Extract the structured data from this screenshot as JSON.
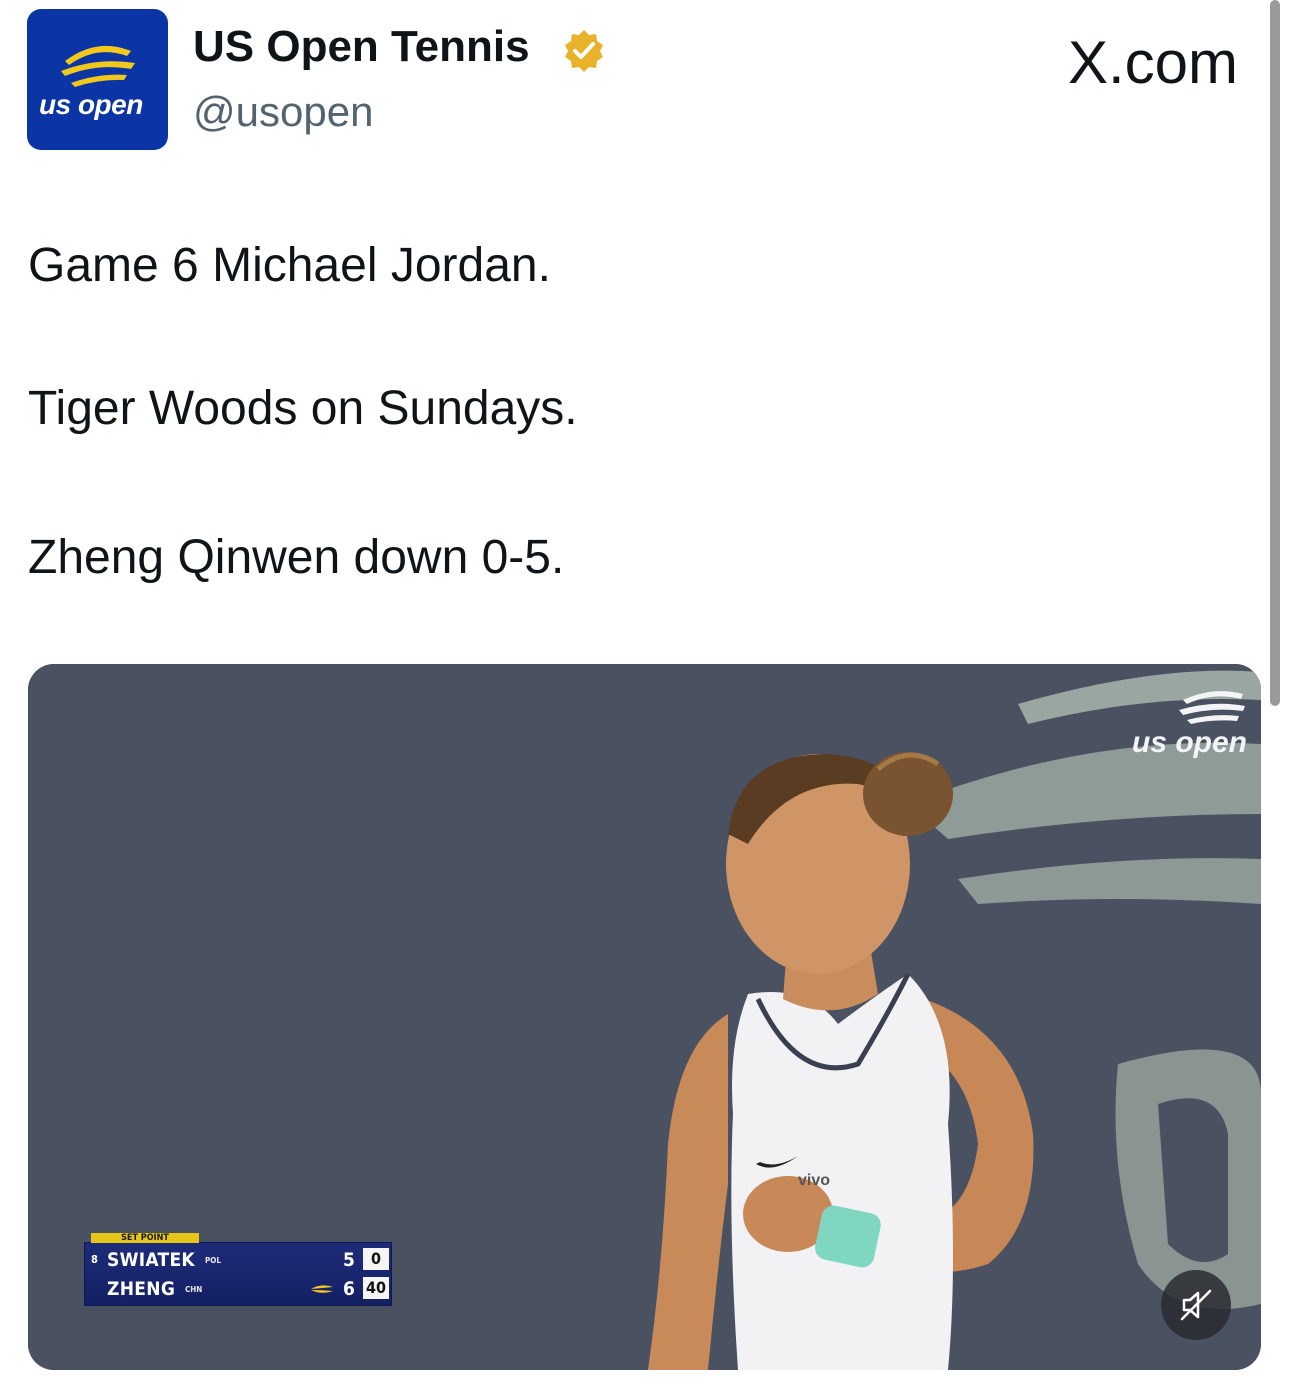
{
  "author": {
    "display_name": "US Open Tennis",
    "handle": "@usopen",
    "avatar_text": "us open",
    "verified": true
  },
  "site_label": "X.com",
  "tweet": {
    "lines": [
      "Game 6 Michael Jordan.",
      "Tiger Woods on Sundays.",
      "Zheng Qinwen down 0-5."
    ]
  },
  "media": {
    "type": "video",
    "overlay_logo_text": "us open",
    "shirt_logo_text": "vivo",
    "scoreboard": {
      "tab_label": "SET POINT",
      "players": [
        {
          "seed": "8",
          "name": "SWIATEK",
          "country": "POL",
          "games": "5",
          "points": "0",
          "serving": false
        },
        {
          "seed": "",
          "name": "ZHENG",
          "country": "CHN",
          "games": "6",
          "points": "40",
          "serving": true
        }
      ]
    },
    "mute_icon": "speaker-muted-icon"
  },
  "colors": {
    "brand_blue": "#0b35a5",
    "brand_yellow": "#f3c81d",
    "verified_gold": "#e8b32a",
    "handle_gray": "#536471"
  }
}
